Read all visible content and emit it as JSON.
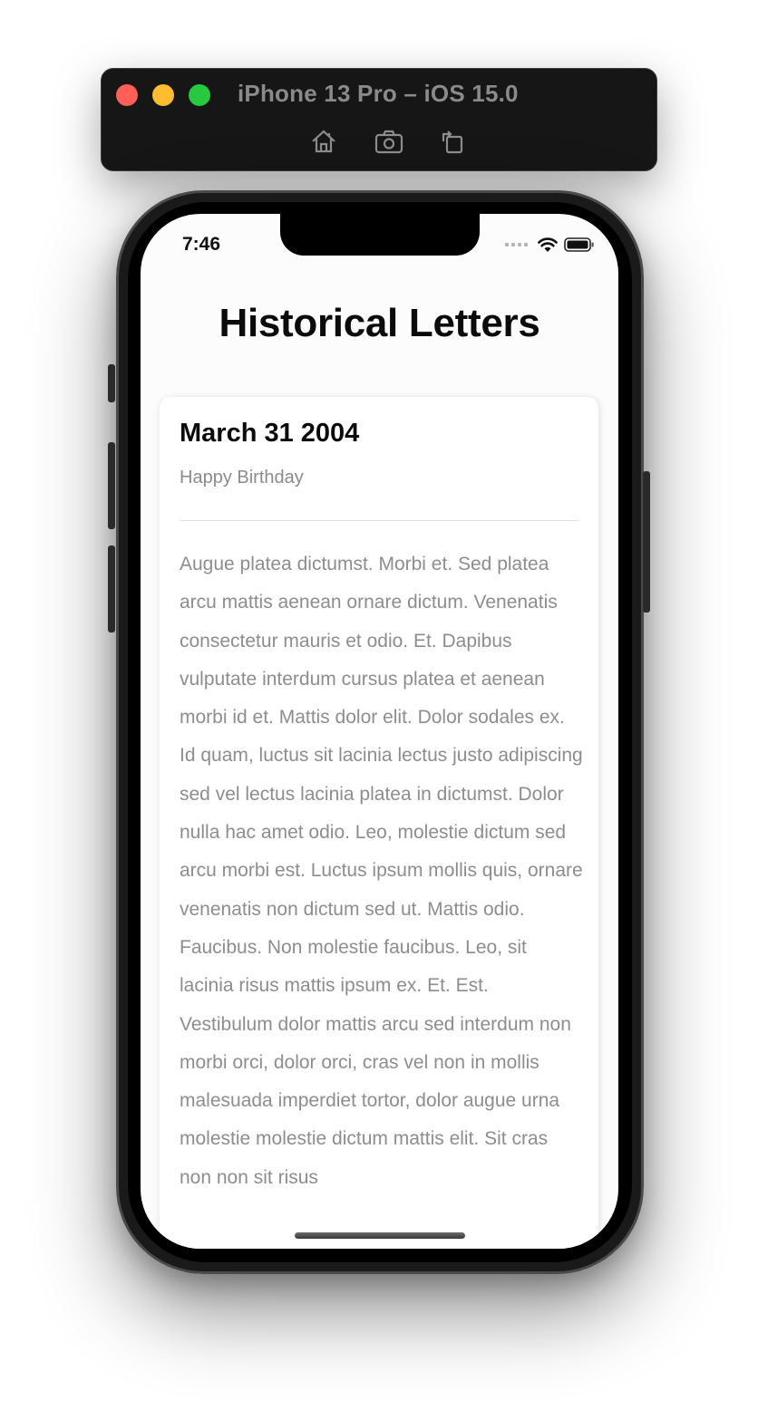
{
  "simulator": {
    "title": "iPhone 13 Pro – iOS 15.0",
    "tools": [
      "home-icon",
      "screenshot-icon",
      "rotate-icon"
    ]
  },
  "status_bar": {
    "time": "7:46",
    "icons": [
      "cellular-icon",
      "wifi-icon",
      "battery-icon"
    ]
  },
  "page": {
    "title": "Historical Letters"
  },
  "letter": {
    "date": "March 31 2004",
    "subtitle": "Happy Birthday",
    "body": "Augue platea dictumst. Morbi et. Sed platea arcu mattis aenean ornare dictum. Venenatis consectetur mauris et odio. Et. Dapibus vulputate interdum cursus platea et aenean morbi id et. Mattis dolor elit. Dolor sodales ex. Id quam, luctus sit lacinia lectus justo adipiscing sed vel lectus lacinia platea in dictumst. Dolor nulla hac amet odio. Leo, molestie dictum sed arcu morbi est. Luctus ipsum mollis quis, ornare venenatis non dictum sed ut. Mattis odio. Faucibus. Non molestie faucibus. Leo, sit lacinia risus mattis ipsum ex. Et. Est. Vestibulum dolor mattis arcu sed interdum non morbi orci, dolor orci, cras vel non in mollis malesuada imperdiet tortor, dolor augue urna molestie molestie dictum mattis elit. Sit cras non non sit risus"
  },
  "colors": {
    "close": "#fe5f57",
    "minimize": "#febc2e",
    "zoom": "#28c840",
    "body_text": "#8d8d8d"
  }
}
